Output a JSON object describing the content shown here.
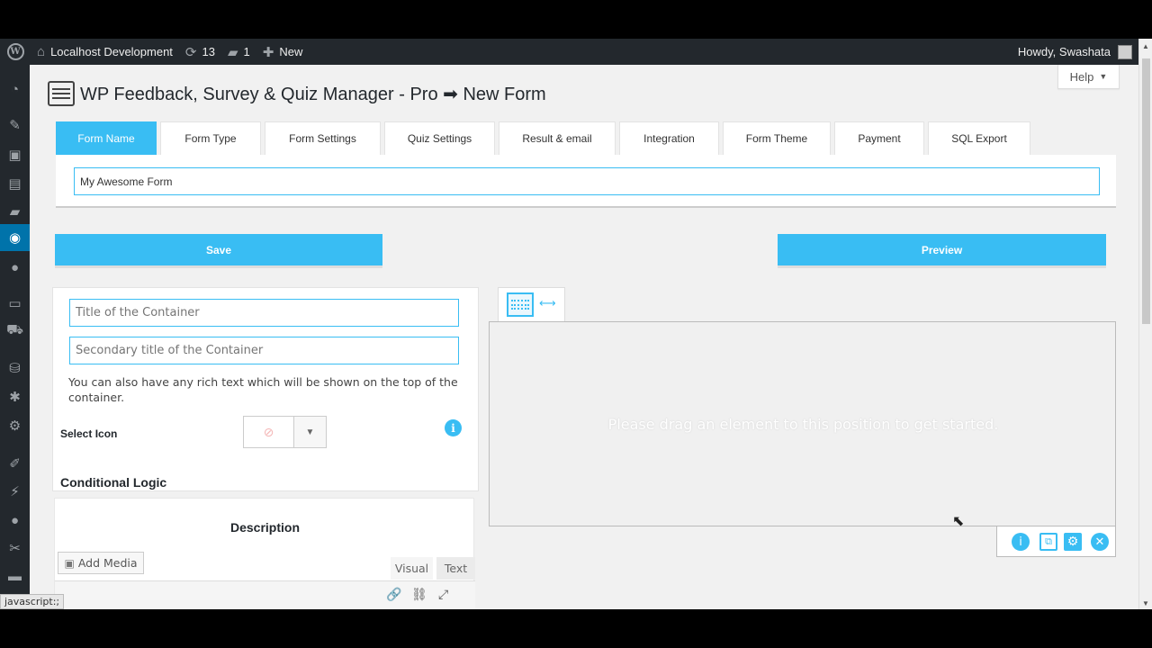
{
  "adminbar": {
    "site_name": "Localhost Development",
    "updates_count": "13",
    "comments_count": "1",
    "new_label": "New",
    "howdy": "Howdy, Swashata"
  },
  "help": {
    "label": "Help"
  },
  "page": {
    "title": "WP Feedback, Survey & Quiz Manager - Pro",
    "arrow": "➡",
    "subtitle": "New Form"
  },
  "tabs": [
    {
      "label": "Form Name",
      "active": true
    },
    {
      "label": "Form Type"
    },
    {
      "label": "Form Settings"
    },
    {
      "label": "Quiz Settings"
    },
    {
      "label": "Result & email"
    },
    {
      "label": "Integration"
    },
    {
      "label": "Form Theme"
    },
    {
      "label": "Payment"
    },
    {
      "label": "SQL Export"
    }
  ],
  "form_name": {
    "value": "My Awesome Form"
  },
  "buttons": {
    "save": "Save",
    "preview": "Preview"
  },
  "container": {
    "title_placeholder": "Title of the Container",
    "subtitle_placeholder": "Secondary title of the Container",
    "rich_text": "You can also have any rich text which will be shown on the top of the container.",
    "select_icon_label": "Select Icon",
    "conditional_logic": "Conditional Logic"
  },
  "description": {
    "title": "Description",
    "add_media": "Add Media",
    "visual_tab": "Visual",
    "text_tab": "Text"
  },
  "droparea": {
    "message": "Please drag an element to this position to get started."
  },
  "statusbar": {
    "text": "javascript:;"
  },
  "colors": {
    "accent": "#39bdf3",
    "adminbar": "#23282d",
    "active_menu": "#0073aa"
  }
}
